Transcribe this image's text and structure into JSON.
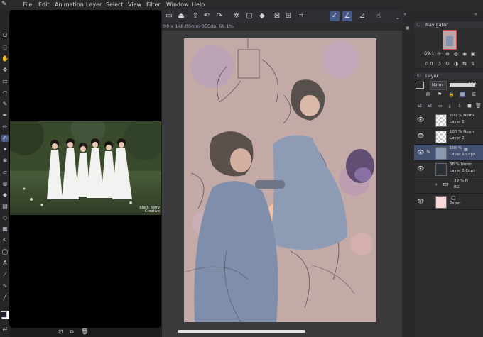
{
  "menubar": {
    "items": [
      "File",
      "Edit",
      "Animation",
      "Layer",
      "Select",
      "View",
      "Filter",
      "Window",
      "Help"
    ]
  },
  "canvas": {
    "info": "00 x 148.00mm 350dpi 69.1%"
  },
  "reference": {
    "watermark_line1": "Black Berry",
    "watermark_line2": "Creative"
  },
  "navigator": {
    "title": "Navigator",
    "zoom": "69.1",
    "rotation": "0.0"
  },
  "layers": {
    "title": "Layer",
    "blend_mode": "Norm",
    "opacity": "100",
    "rows": [
      {
        "percent": "100 % Norm",
        "name": "Layer 1",
        "type": "empty"
      },
      {
        "percent": "100 % Norm",
        "name": "Layer 2",
        "type": "empty"
      },
      {
        "percent": "100 %",
        "name": "Layer 3 Copy",
        "type": "art",
        "selected": true
      },
      {
        "percent": "38 % Norm",
        "name": "Layer 3 Copy",
        "type": "dark"
      },
      {
        "percent": "39 % N",
        "name": "BG",
        "type": "folder"
      },
      {
        "percent": "",
        "name": "Paper",
        "type": "paper"
      }
    ]
  },
  "colors": {
    "accent": "#475a88",
    "selected_row": "#43506f",
    "paper": "#f8d8d8"
  }
}
